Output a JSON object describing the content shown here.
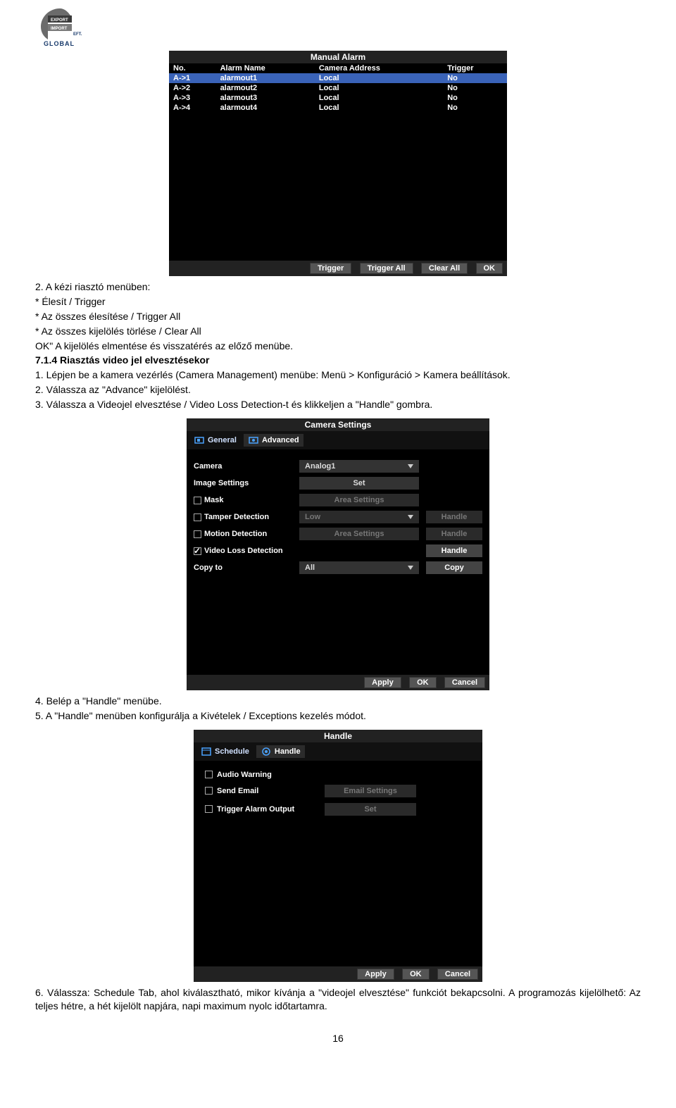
{
  "logo": {
    "brand_top": "EXPORT",
    "brand_bottom": "IMPORT",
    "brand_main": "GLOBAL",
    "brand_suffix": "EFT."
  },
  "manual_alarm": {
    "title": "Manual Alarm",
    "columns": [
      "No.",
      "Alarm Name",
      "Camera Address",
      "Trigger"
    ],
    "rows": [
      {
        "no": "A->1",
        "name": "alarmout1",
        "addr": "Local",
        "trigger": "No",
        "selected": true
      },
      {
        "no": "A->2",
        "name": "alarmout2",
        "addr": "Local",
        "trigger": "No",
        "selected": false
      },
      {
        "no": "A->3",
        "name": "alarmout3",
        "addr": "Local",
        "trigger": "No",
        "selected": false
      },
      {
        "no": "A->4",
        "name": "alarmout4",
        "addr": "Local",
        "trigger": "No",
        "selected": false
      }
    ],
    "buttons": {
      "trigger": "Trigger",
      "trigger_all": "Trigger All",
      "clear_all": "Clear All",
      "ok": "OK"
    }
  },
  "doc_block1": {
    "l1": "2. A kézi riasztó menüben:",
    "l2": "* Élesít / Trigger",
    "l3": "* Az összes élesítése / Trigger All",
    "l4": "* Az összes kijelölés törlése / Clear All",
    "l5": "OK\" A kijelölés elmentése és visszatérés az előző menübe.",
    "heading": "7.1.4 Riasztás video jel elvesztésekor",
    "s1": "1. Lépjen be a kamera vezérlés (Camera Management) menübe: Menü > Konfiguráció > Kamera beállítások.",
    "s2": "2. Válassza az \"Advance\" kijelölést.",
    "s3": "3. Válassza a Videojel elvesztése / Video Loss Detection-t és klikkeljen a \"Handle\" gombra."
  },
  "camera_settings": {
    "title": "Camera Settings",
    "tabs": {
      "general": "General",
      "advanced": "Advanced"
    },
    "rows": {
      "camera_label": "Camera",
      "camera_value": "Analog1",
      "image_label": "Image Settings",
      "image_btn": "Set",
      "mask_label": "Mask",
      "mask_field": "Area Settings",
      "tamper_label": "Tamper Detection",
      "tamper_field": "Low",
      "tamper_btn": "Handle",
      "motion_label": "Motion Detection",
      "motion_field": "Area Settings",
      "motion_btn": "Handle",
      "vloss_label": "Video Loss Detection",
      "vloss_btn": "Handle",
      "copy_label": "Copy to",
      "copy_field": "All",
      "copy_btn": "Copy"
    },
    "buttons": {
      "apply": "Apply",
      "ok": "OK",
      "cancel": "Cancel"
    }
  },
  "doc_block2": {
    "l1": "4. Belép a \"Handle\" menübe.",
    "l2": "5. A \"Handle\" menüben konfigurálja a Kivételek / Exceptions kezelés módot."
  },
  "handle_panel": {
    "title": "Handle",
    "tabs": {
      "schedule": "Schedule",
      "handle": "Handle"
    },
    "rows": {
      "audio": "Audio Warning",
      "email": "Send Email",
      "email_btn": "Email Settings",
      "trigger": "Trigger Alarm Output",
      "trigger_btn": "Set"
    },
    "buttons": {
      "apply": "Apply",
      "ok": "OK",
      "cancel": "Cancel"
    }
  },
  "doc_block3": {
    "p": "6. Válassza: Schedule Tab, ahol kiválasztható, mikor kívánja a \"videojel elvesztése\" funkciót bekapcsolni. A programozás kijelölhető: Az teljes hétre, a hét kijelölt napjára, napi maximum nyolc időtartamra."
  },
  "page_number": "16"
}
